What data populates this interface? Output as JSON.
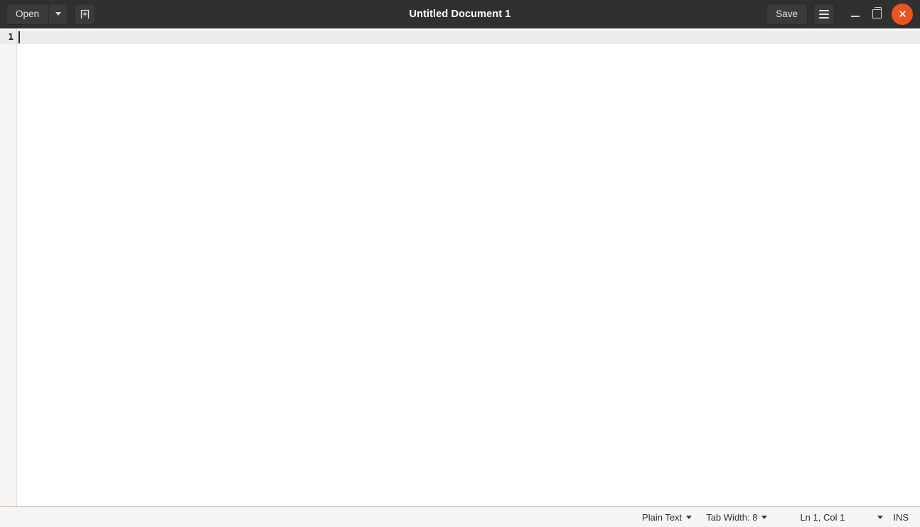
{
  "window": {
    "title": "Untitled Document 1"
  },
  "headerbar": {
    "open_label": "Open",
    "open_dropdown_icon": "chevron-down-icon",
    "new_document_icon": "new-document-icon",
    "save_label": "Save",
    "menu_icon": "hamburger-menu-icon",
    "minimize_icon": "minimize-icon",
    "maximize_icon": "maximize-icon",
    "close_icon": "close-icon",
    "colors": {
      "background": "#303030",
      "button": "#3a3a3a",
      "text": "#e6e4e1",
      "close_button": "#e95420"
    }
  },
  "editor": {
    "line_numbers": [
      "1"
    ],
    "content": "",
    "caret_line": 1,
    "caret_column": 1
  },
  "statusbar": {
    "language_label": "Plain Text",
    "language_dropdown_icon": "chevron-down-icon",
    "tab_width_label": "Tab Width: 8",
    "tab_width_dropdown_icon": "chevron-down-icon",
    "position_label": "Ln 1, Col 1",
    "position_dropdown_icon": "chevron-down-icon",
    "insert_mode_label": "INS"
  }
}
